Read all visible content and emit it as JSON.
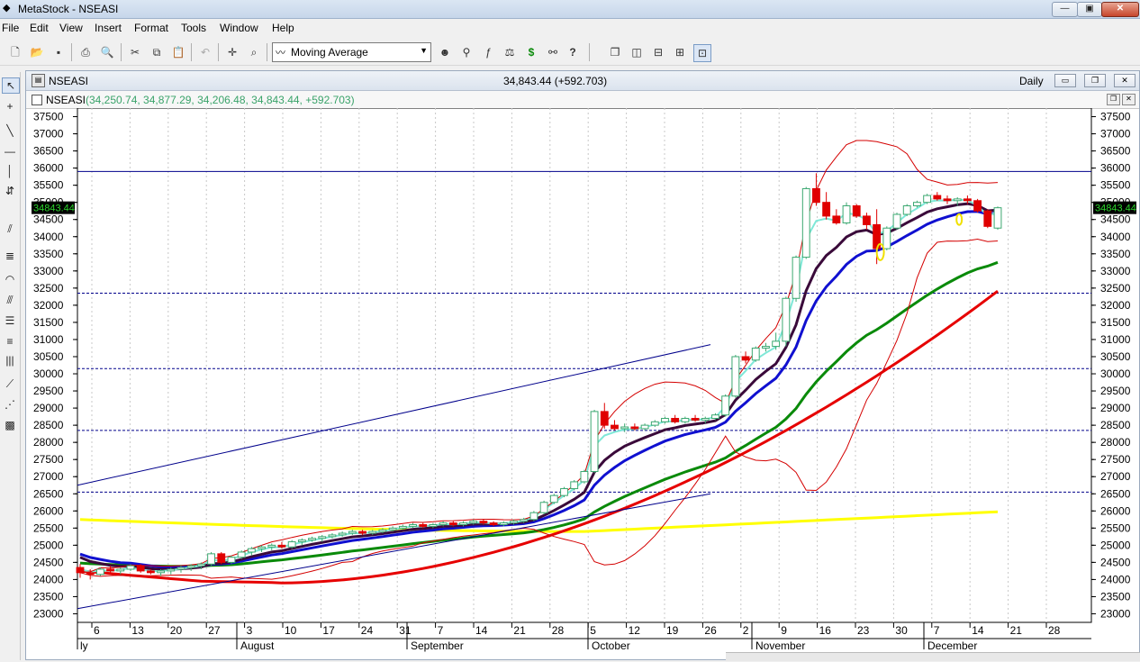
{
  "window": {
    "title": "MetaStock - NSEASI",
    "icon": "metastock-logo-icon",
    "buttons": {
      "minimize": "—",
      "maximize": "▣",
      "close": "✕"
    }
  },
  "menu": [
    "File",
    "Edit",
    "View",
    "Insert",
    "Format",
    "Tools",
    "Window",
    "Help"
  ],
  "toolbar": {
    "indicator_select": "Moving Average",
    "icons": [
      "new-icon",
      "open-icon",
      "save-icon",
      "print-icon",
      "print-preview-icon",
      "cut-icon",
      "copy-icon",
      "paste-icon",
      "undo-icon",
      "crosshair-icon",
      "zoom-icon",
      "indicator-icon",
      "explorer-icon",
      "expert-advisor-icon",
      "function-icon",
      "system-tester-icon",
      "dollar-icon",
      "binoculars-icon",
      "help-cursor-icon",
      "cascade-icon",
      "tile-vertical-icon",
      "tile-horizontal-icon",
      "tile-grid-icon",
      "arrange-icon"
    ]
  },
  "chart_window": {
    "name": "NSEASI",
    "quote": "34,843.44 (+592.703)",
    "periodicity": "Daily",
    "inner_symbol": "NSEASI",
    "inner_values": "(34,250.74, 34,877.29, 34,206.48, 34,843.44, +592.703)",
    "last_price_label": "34843.44"
  },
  "colors": {
    "background": "#ffffff",
    "bull_candle": "#3ca871",
    "bear_candle": "#e00000",
    "ma_yellow": "#ffff00",
    "ma_red": "#e60000",
    "ma_green": "#0a8a0a",
    "ma_blue": "#1010d0",
    "ma_purple": "#3a0a3a",
    "ma_cyan": "#7fe8d8",
    "bollinger": "#d40000",
    "trendline": "#00008b",
    "hline": "#00008b"
  },
  "chart_data": {
    "type": "candlestick",
    "y_ticks": [
      23000,
      23500,
      24000,
      24500,
      25000,
      25500,
      26000,
      26500,
      27000,
      27500,
      28000,
      28500,
      29000,
      29500,
      30000,
      30500,
      31000,
      31500,
      32000,
      32500,
      33000,
      33500,
      34000,
      34500,
      35000,
      35500,
      36000,
      36500,
      37000,
      37500
    ],
    "ylim": [
      22750,
      37750
    ],
    "x_day_labels": [
      "6",
      "13",
      "20",
      "27",
      "3",
      "10",
      "17",
      "24",
      "31",
      "7",
      "14",
      "21",
      "28",
      "5",
      "12",
      "19",
      "26",
      "2",
      "9",
      "16",
      "23",
      "30",
      "7",
      "14",
      "21",
      "28"
    ],
    "x_month_labels": [
      "ly",
      "August",
      "September",
      "October",
      "November",
      "December"
    ],
    "horizontal_lines": [
      35900,
      32350,
      30150,
      28350,
      26550
    ],
    "candles": [
      [
        24350,
        24450,
        24050,
        24200
      ],
      [
        24200,
        24300,
        24000,
        24150
      ],
      [
        24150,
        24350,
        24100,
        24300
      ],
      [
        24300,
        24400,
        24200,
        24250
      ],
      [
        24250,
        24350,
        24150,
        24300
      ],
      [
        24300,
        24450,
        24250,
        24400
      ],
      [
        24400,
        24450,
        24200,
        24250
      ],
      [
        24250,
        24300,
        24150,
        24200
      ],
      [
        24200,
        24300,
        24100,
        24250
      ],
      [
        24250,
        24350,
        24150,
        24300
      ],
      [
        24300,
        24400,
        24200,
        24350
      ],
      [
        24350,
        24450,
        24250,
        24400
      ],
      [
        24400,
        24500,
        24300,
        24450
      ],
      [
        24450,
        24800,
        24400,
        24750
      ],
      [
        24750,
        24800,
        24450,
        24500
      ],
      [
        24500,
        24700,
        24450,
        24650
      ],
      [
        24650,
        24850,
        24600,
        24800
      ],
      [
        24800,
        24950,
        24700,
        24900
      ],
      [
        24900,
        25000,
        24800,
        24950
      ],
      [
        24950,
        25050,
        24850,
        25000
      ],
      [
        25000,
        25100,
        24900,
        24950
      ],
      [
        24950,
        25150,
        24900,
        25100
      ],
      [
        25100,
        25200,
        25000,
        25150
      ],
      [
        25150,
        25250,
        25100,
        25200
      ],
      [
        25200,
        25300,
        25100,
        25250
      ],
      [
        25250,
        25350,
        25200,
        25300
      ],
      [
        25300,
        25400,
        25250,
        25350
      ],
      [
        25350,
        25450,
        25300,
        25400
      ],
      [
        25400,
        25450,
        25300,
        25350
      ],
      [
        25350,
        25450,
        25300,
        25400
      ],
      [
        25400,
        25500,
        25350,
        25450
      ],
      [
        25450,
        25550,
        25400,
        25500
      ],
      [
        25500,
        25600,
        25450,
        25550
      ],
      [
        25550,
        25650,
        25500,
        25600
      ],
      [
        25600,
        25650,
        25500,
        25550
      ],
      [
        25550,
        25650,
        25500,
        25600
      ],
      [
        25600,
        25700,
        25550,
        25650
      ],
      [
        25650,
        25700,
        25550,
        25600
      ],
      [
        25600,
        25700,
        25550,
        25650
      ],
      [
        25650,
        25750,
        25600,
        25700
      ],
      [
        25700,
        25750,
        25600,
        25650
      ],
      [
        25650,
        25700,
        25550,
        25600
      ],
      [
        25600,
        25700,
        25550,
        25650
      ],
      [
        25650,
        25750,
        25600,
        25700
      ],
      [
        25700,
        25800,
        25650,
        25750
      ],
      [
        25750,
        26000,
        25700,
        25950
      ],
      [
        25950,
        26300,
        25900,
        26250
      ],
      [
        26250,
        26500,
        26200,
        26450
      ],
      [
        26450,
        26700,
        26400,
        26650
      ],
      [
        26650,
        26900,
        26600,
        26850
      ],
      [
        26850,
        27200,
        26800,
        27150
      ],
      [
        27150,
        28950,
        27100,
        28900
      ],
      [
        28900,
        29150,
        28400,
        28500
      ],
      [
        28500,
        28650,
        28350,
        28400
      ],
      [
        28400,
        28550,
        28300,
        28450
      ],
      [
        28450,
        28550,
        28350,
        28400
      ],
      [
        28400,
        28550,
        28350,
        28500
      ],
      [
        28500,
        28650,
        28450,
        28600
      ],
      [
        28600,
        28750,
        28550,
        28700
      ],
      [
        28700,
        28800,
        28550,
        28600
      ],
      [
        28600,
        28750,
        28550,
        28700
      ],
      [
        28700,
        28800,
        28600,
        28650
      ],
      [
        28650,
        28750,
        28550,
        28700
      ],
      [
        28700,
        28850,
        28650,
        28800
      ],
      [
        28800,
        29400,
        28750,
        29350
      ],
      [
        29350,
        30550,
        29300,
        30500
      ],
      [
        30500,
        30650,
        30300,
        30400
      ],
      [
        30400,
        30800,
        30350,
        30750
      ],
      [
        30750,
        30900,
        30650,
        30800
      ],
      [
        30800,
        31200,
        30700,
        30950
      ],
      [
        30950,
        32250,
        30800,
        32200
      ],
      [
        32200,
        33450,
        32100,
        33400
      ],
      [
        33400,
        35450,
        33350,
        35400
      ],
      [
        35400,
        35850,
        34900,
        35000
      ],
      [
        35000,
        35300,
        34500,
        34600
      ],
      [
        34600,
        34800,
        34350,
        34400
      ],
      [
        34400,
        35000,
        34350,
        34900
      ],
      [
        34900,
        34950,
        34550,
        34600
      ],
      [
        34600,
        34700,
        34200,
        34350
      ],
      [
        34350,
        34800,
        33200,
        33650
      ],
      [
        33650,
        34300,
        33600,
        34250
      ],
      [
        34250,
        34700,
        34200,
        34650
      ],
      [
        34650,
        34950,
        34600,
        34900
      ],
      [
        34900,
        35050,
        34850,
        35000
      ],
      [
        35000,
        35250,
        34950,
        35200
      ],
      [
        35200,
        35300,
        35050,
        35100
      ],
      [
        35100,
        35200,
        34950,
        35050
      ],
      [
        35050,
        35150,
        34900,
        35100
      ],
      [
        35100,
        35200,
        34950,
        35050
      ],
      [
        35050,
        35100,
        34700,
        34750
      ],
      [
        34750,
        34800,
        34250,
        34300
      ],
      [
        34250,
        34880,
        34200,
        34843
      ]
    ]
  }
}
